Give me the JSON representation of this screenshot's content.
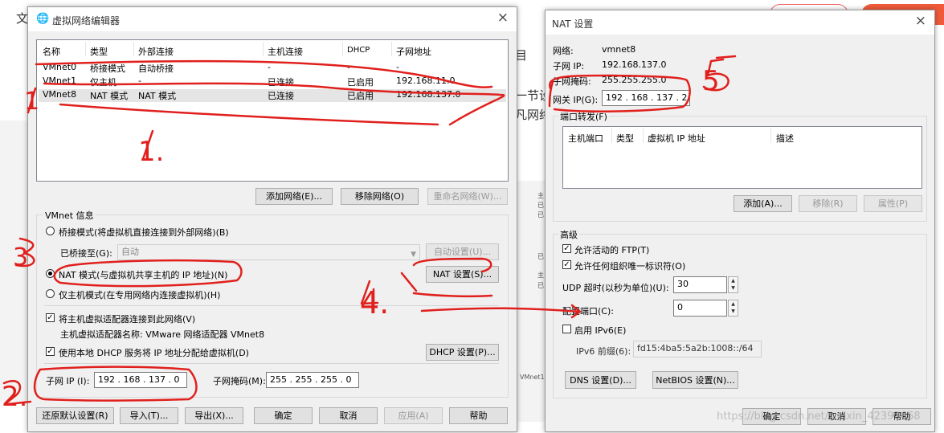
{
  "background": {
    "left_char": "文",
    "frag_right1": "目",
    "frag_right2": "一节设",
    "frag_right3": "凡网络",
    "frag_misc": [
      "主",
      "已",
      "已",
      "已",
      "主",
      "已"
    ],
    "frag_vmnet": "VMnet1"
  },
  "editor": {
    "title": "虚拟网络编辑器",
    "close": "×",
    "table": {
      "headers": [
        "名称",
        "类型",
        "外部连接",
        "主机连接",
        "DHCP",
        "子网地址"
      ],
      "rows": [
        [
          "VMnet0",
          "桥接模式",
          "自动桥接",
          "-",
          "-",
          "-"
        ],
        [
          "VMnet1",
          "仅主机...",
          "-",
          "已连接",
          "已启用",
          "192.168.11.0"
        ],
        [
          "VMnet8",
          "NAT 模式",
          "NAT 模式",
          "已连接",
          "已启用",
          "192.168.137.0"
        ]
      ]
    },
    "buttons_top": {
      "add": "添加网络(E)...",
      "remove": "移除网络(O)",
      "rename": "重命名网络(W)..."
    },
    "group_title": "VMnet 信息",
    "bridge_label": "桥接模式(将虚拟机直接连接到外部网络)(B)",
    "bridged_to_label": "已桥接至(G):",
    "bridged_to_value": "自动",
    "auto_settings": "自动设置(U)...",
    "nat_label": "NAT 模式(与虚拟机共享主机的 IP 地址)(N)",
    "nat_settings": "NAT 设置(S)...",
    "hostonly_label": "仅主机模式(在专用网络内连接虚拟机)(H)",
    "connect_adapter_label": "将主机虚拟适配器连接到此网络(V)",
    "adapter_name": "主机虚拟适配器名称: VMware 网络适配器 VMnet8",
    "dhcp_label": "使用本地 DHCP 服务将 IP 地址分配给虚拟机(D)",
    "dhcp_settings": "DHCP 设置(P)...",
    "subnet_ip_label": "子网 IP (I):",
    "subnet_ip": "192 . 168 . 137 . 0",
    "mask_label": "子网掩码(M):",
    "mask": "255 . 255 . 255 . 0",
    "bottom_buttons": [
      "还原默认设置(R)",
      "导入(T)...",
      "导出(X)...",
      "确定",
      "取消",
      "应用(A)",
      "帮助"
    ]
  },
  "nat": {
    "title": "NAT 设置",
    "close": "×",
    "network_label": "网络:",
    "network_value": "vmnet8",
    "subnet_ip_label": "子网 IP:",
    "subnet_ip_value": "192.168.137.0",
    "mask_label": "子网掩码:",
    "mask_value": "255.255.255.0",
    "gateway_label": "网关 IP(G):",
    "gateway_value": "192 . 168 . 137 . 2",
    "port_forward_label": "端口转发(F)",
    "pf_headers": [
      "主机端口",
      "类型",
      "虚拟机 IP 地址",
      "描述"
    ],
    "pf_buttons": {
      "add": "添加(A)...",
      "remove": "移除(R)",
      "props": "属性(P)"
    },
    "advanced_label": "高级",
    "ftp_label": "允许活动的 FTP(T)",
    "oui_label": "允许任何组织唯一标识符(O)",
    "udp_label": "UDP 超时(以秒为单位)(U):",
    "udp_value": "30",
    "config_port_label": "配置端口(C):",
    "config_port_value": "0",
    "ipv6_label": "启用 IPv6(E)",
    "ipv6_prefix_label": "IPv6 前缀(6):",
    "ipv6_prefix_value": "fd15:4ba5:5a2b:1008::/64",
    "dns_button": "DNS 设置(D)...",
    "netbios_button": "NetBIOS 设置(N)...",
    "ok": "确定",
    "cancel": "取消",
    "help": "帮助"
  },
  "watermark": "https://blog.csdn.net/weixin_42393668",
  "annotations": {
    "n1": "1",
    "n1b": "1.",
    "n2": "2.",
    "n3": "3",
    "n4": "4.",
    "n5": "5"
  }
}
